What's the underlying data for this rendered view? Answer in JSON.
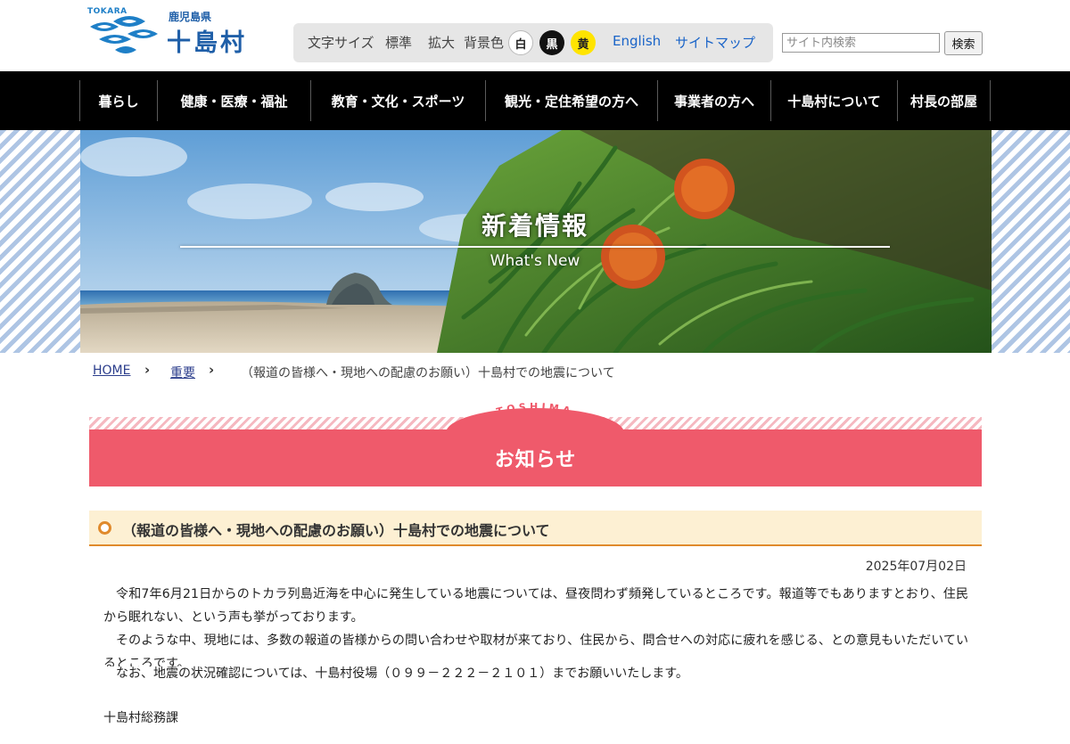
{
  "header": {
    "logo_latin": "TOKARA",
    "prefecture": "鹿児島県",
    "village": "十島村",
    "tools": {
      "font_size_label": "文字サイズ",
      "font_standard": "標準",
      "font_large": "拡大",
      "bg_color_label": "背景色",
      "bg_white": "白",
      "bg_black": "黒",
      "bg_yellow": "黄",
      "english": "English",
      "sitemap": "サイトマップ"
    },
    "search": {
      "placeholder": "サイト内検索",
      "button": "検索"
    }
  },
  "nav": {
    "items": [
      "暮らし",
      "健康・医療・福祉",
      "教育・文化・スポーツ",
      "観光・定住希望の方へ",
      "事業者の方へ",
      "十島村について",
      "村長の部屋"
    ]
  },
  "hero": {
    "title": "新着情報",
    "subtitle": "What's New"
  },
  "breadcrumb": {
    "home": "HOME",
    "category": "重要",
    "current": "（報道の皆様へ・現地への配慮のお願い）十島村での地震について"
  },
  "section": {
    "arc_text": "TOSHIMA",
    "label": "お知らせ"
  },
  "article": {
    "title": "（報道の皆様へ・現地への配慮のお願い）十島村での地震について",
    "date": "2025年07月02日",
    "paragraphs": [
      "令和7年6月21日からのトカラ列島近海を中心に発生している地震については、昼夜問わず頻発しているところです。報道等でもありますとおり、住民から眠れない、という声も挙がっております。",
      "そのような中、現地には、多数の報道の皆様からの問い合わせや取材が来ており、住民から、問合せへの対応に疲れを感じる、との意見もいただいているところです。"
    ],
    "contact": "なお、地震の状況確認については、十島村役場（０９９－２２２－２１０１）までお願いいたします。",
    "signature": "十島村総務課"
  },
  "colors": {
    "brand_blue": "#1f5fa8",
    "nav_bg": "#000000",
    "section_pink": "#ef5a6b",
    "article_accent": "#e08a2c",
    "article_bar_bg": "#fdf0d3",
    "link_blue": "#1a64c8"
  },
  "icons": {
    "logo": "wave-crest-icon",
    "breadcrumb_separator": "chevron-right-icon",
    "article_marker": "circle-icon"
  }
}
